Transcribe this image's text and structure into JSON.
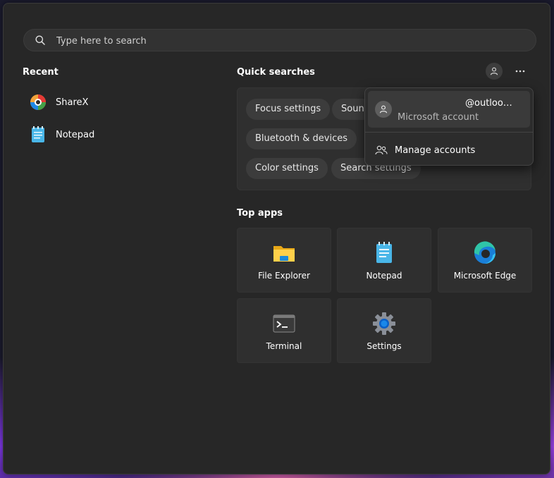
{
  "search": {
    "placeholder": "Type here to search",
    "icon": "search-icon"
  },
  "recent": {
    "heading": "Recent",
    "items": [
      {
        "label": "ShareX",
        "icon": "sharex-icon"
      },
      {
        "label": "Notepad",
        "icon": "notepad-icon"
      }
    ]
  },
  "quick_searches": {
    "heading": "Quick searches",
    "chips": [
      "Focus settings",
      "Soun",
      "Bluetooth & devices",
      "Color settings",
      "Search settings"
    ]
  },
  "header_buttons": {
    "account_icon": "person-icon",
    "more_icon": "more-icon"
  },
  "account_popup": {
    "email": "@outloo…",
    "account_type": "Microsoft account",
    "manage_label": "Manage accounts"
  },
  "top_apps": {
    "heading": "Top apps",
    "apps": [
      {
        "label": "File Explorer",
        "icon": "folder-icon"
      },
      {
        "label": "Notepad",
        "icon": "notepad-icon"
      },
      {
        "label": "Microsoft Edge",
        "icon": "edge-icon"
      },
      {
        "label": "Terminal",
        "icon": "terminal-icon"
      },
      {
        "label": "Settings",
        "icon": "gear-icon"
      }
    ]
  },
  "colors": {
    "panel": "#272727",
    "chip": "#3c3c3c",
    "tile": "#2f2f2f",
    "accent": "#0078d4"
  }
}
